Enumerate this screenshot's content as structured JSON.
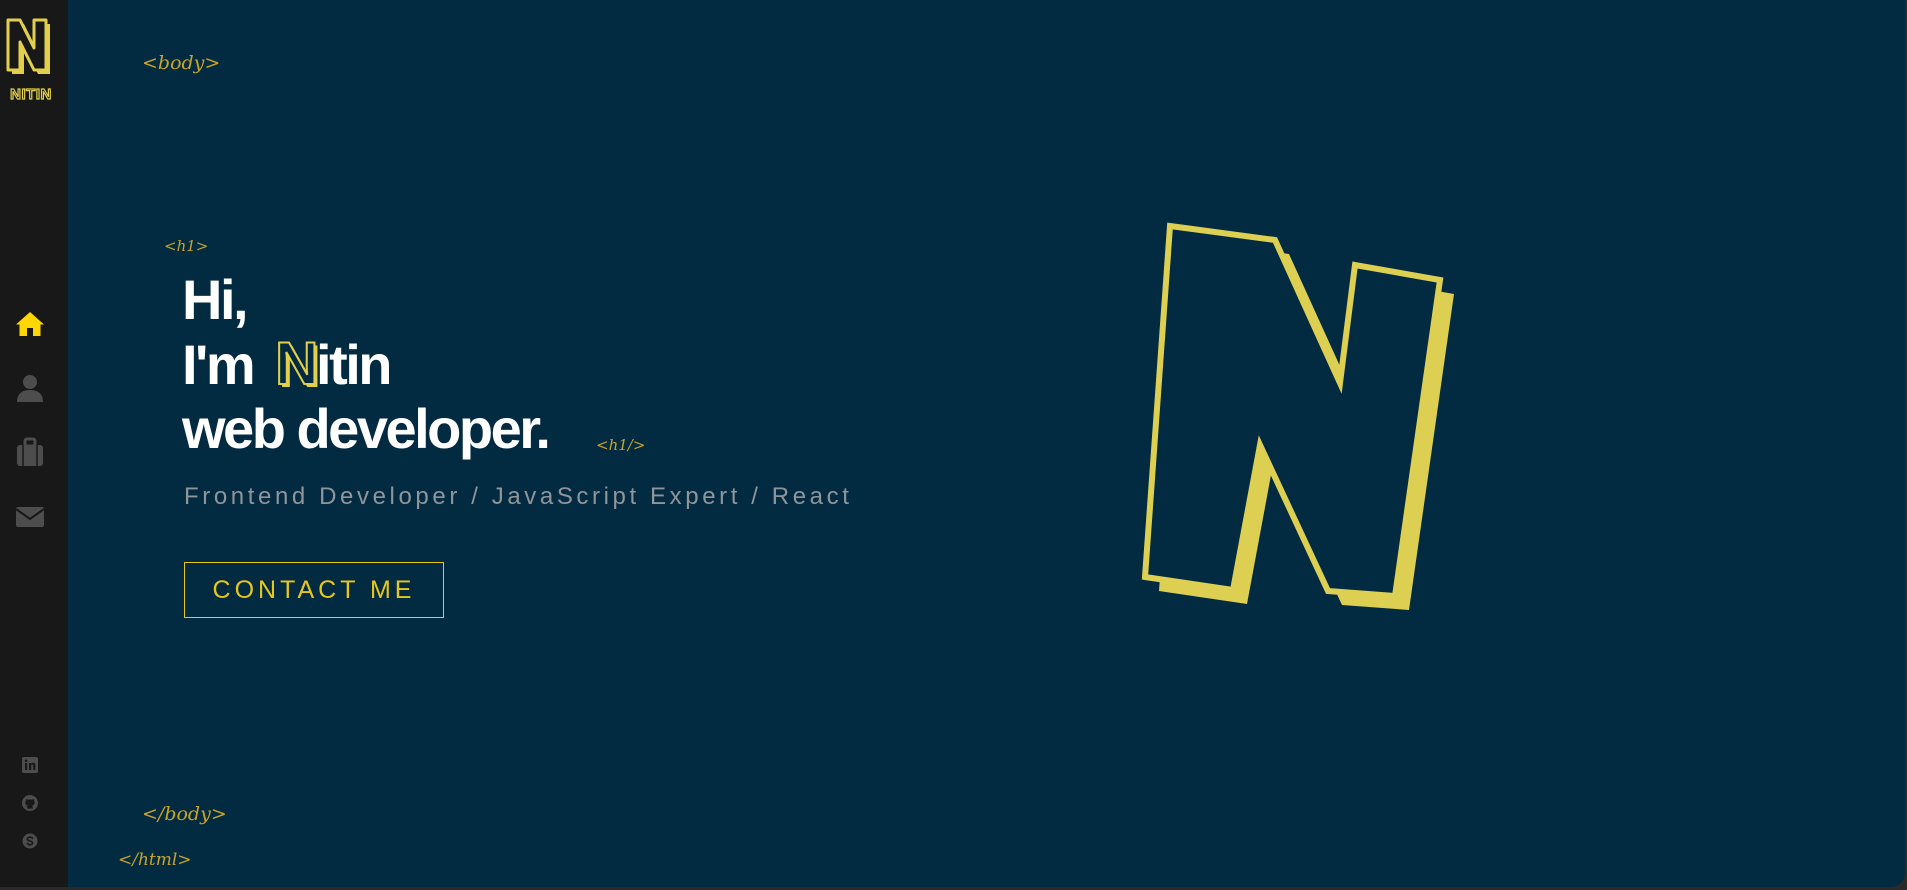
{
  "sidebar": {
    "logo_letter": "N",
    "logo_text": "NITIN",
    "nav": [
      {
        "icon": "home-icon",
        "active": true
      },
      {
        "icon": "user-icon",
        "active": false
      },
      {
        "icon": "briefcase-icon",
        "active": false
      },
      {
        "icon": "envelope-icon",
        "active": false
      }
    ],
    "social": [
      {
        "icon": "linkedin-icon"
      },
      {
        "icon": "github-icon"
      },
      {
        "icon": "skype-icon"
      }
    ]
  },
  "tags": {
    "body_open": "<body>",
    "h1_open": "<h1>",
    "h1_close": "<h1/>",
    "body_close": "</body>",
    "html_close": "</html>"
  },
  "hero": {
    "greeting": "Hi,",
    "intro": "I'm",
    "name_initial": "N",
    "name_rest": "itin",
    "role": "web developer.",
    "subtitle": "Frontend Developer / JavaScript Expert / React",
    "cta_label": "CONTACT ME"
  },
  "colors": {
    "background": "#022b42",
    "sidebar": "#181818",
    "accent": "#e2cf4b",
    "button": "#e8c61a",
    "active_icon": "#ffd700",
    "inactive_icon": "#4d4d4e",
    "tag": "#c9a42a",
    "subtitle": "#8f9599"
  }
}
